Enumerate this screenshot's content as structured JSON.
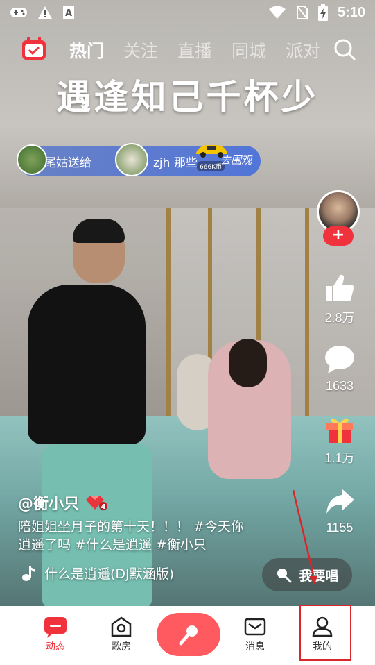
{
  "status_bar": {
    "time": "5:10",
    "icons": [
      "gamepad-icon",
      "warning-icon",
      "font-a-icon",
      "wifi-icon",
      "no-sim-icon",
      "battery-charging-icon"
    ]
  },
  "top_nav": {
    "tabs": [
      {
        "label": "热门",
        "active": true
      },
      {
        "label": "关注",
        "active": false
      },
      {
        "label": "直播",
        "active": false
      },
      {
        "label": "同城",
        "active": false
      },
      {
        "label": "派对",
        "active": false
      }
    ]
  },
  "video": {
    "headline": "遇逢知己千杯少"
  },
  "gift_banner": {
    "sender": "尾姑送给",
    "receiver": "zjh 那些",
    "gift_price": "666K币",
    "action": "去围观"
  },
  "right_rail": {
    "follow_label": "+",
    "likes": "2.8万",
    "comments": "1633",
    "gifts": "1.1万",
    "shares": "1155"
  },
  "caption": {
    "author": "@衡小只",
    "level_badge": "4",
    "description": "陪姐姐坐月子的第十天！！！ #今天你逍遥了吗 #什么是逍遥 #衡小只",
    "music": "什么是逍遥(DJ默涵版)",
    "sing_button": "我要唱"
  },
  "bottom_nav": {
    "items": [
      {
        "label": "动态",
        "active": true
      },
      {
        "label": "歌房",
        "active": false
      },
      {
        "label": "",
        "active": false
      },
      {
        "label": "消息",
        "active": false
      },
      {
        "label": "我的",
        "active": false
      }
    ]
  },
  "colors": {
    "accent_red": "#f0323c",
    "sing_pink": "#ff5a5f",
    "highlight_red": "#d8262b"
  }
}
